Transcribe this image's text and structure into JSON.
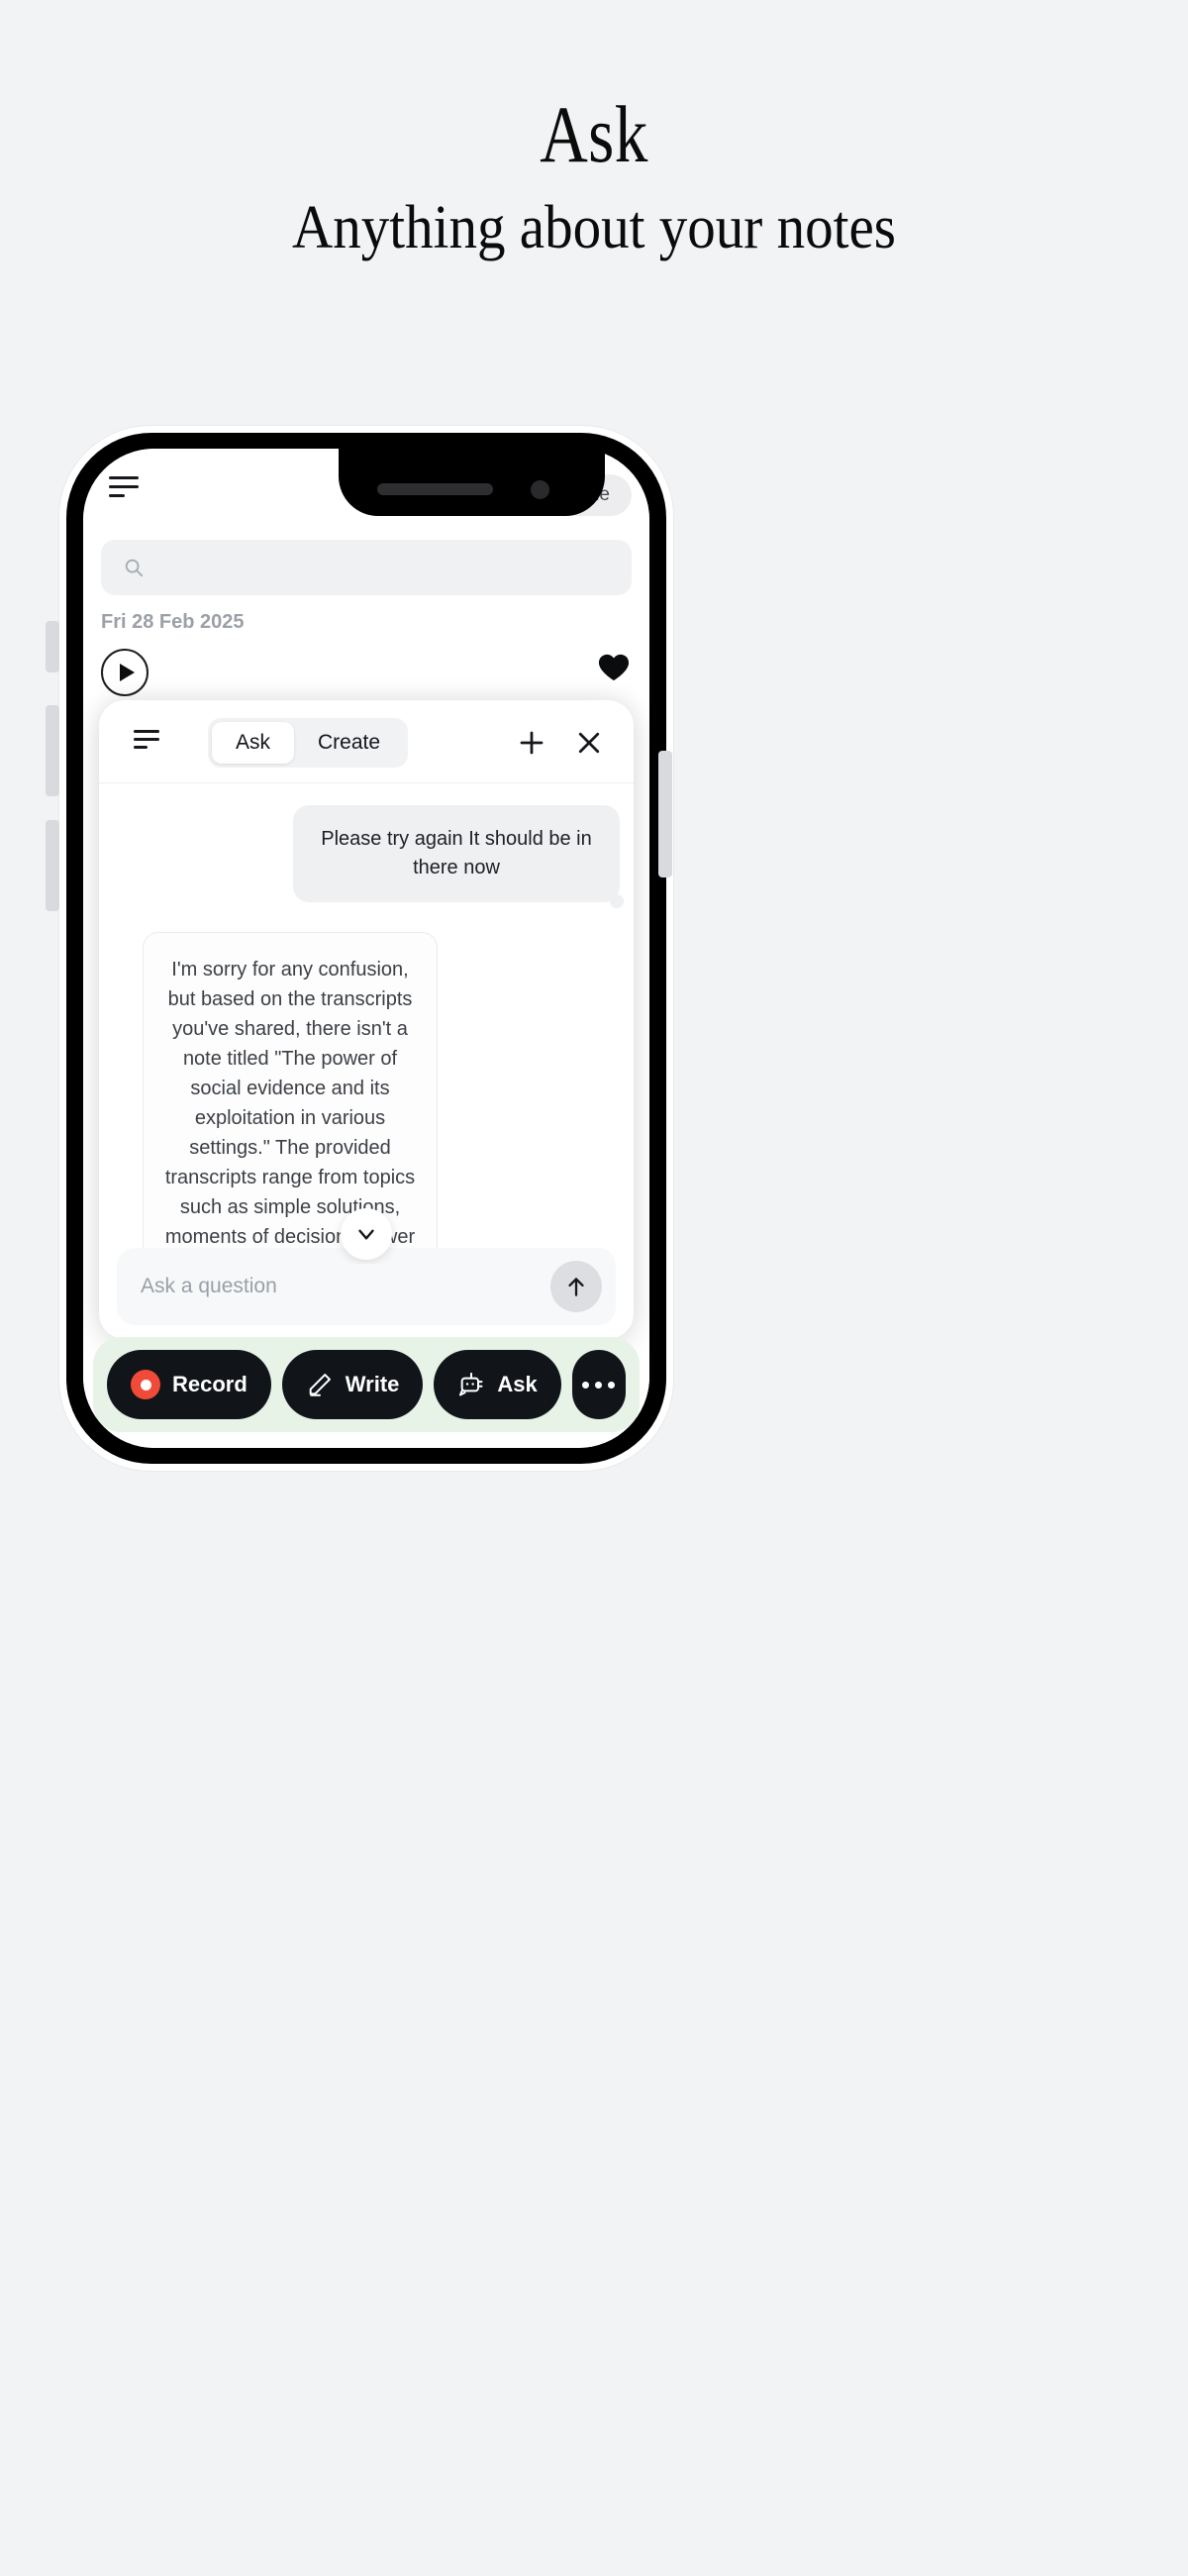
{
  "hero": {
    "title": "Ask",
    "subtitle": "Anything about your notes"
  },
  "app": {
    "topbar": {
      "menu_icon": "hamburger-icon",
      "upgrade_label": "Upgrade",
      "upgrade_icon": "sparkle-icon"
    },
    "search": {
      "icon": "search-icon",
      "placeholder": "",
      "value": ""
    },
    "note": {
      "date": "Fri 28 Feb 2025",
      "play_icon": "play-icon",
      "favorite_icon": "heart-filled-icon"
    },
    "ask_panel": {
      "menu_icon": "hamburger-icon",
      "tabs": [
        {
          "label": "Ask",
          "active": true
        },
        {
          "label": "Create",
          "active": false
        }
      ],
      "add_icon": "plus-icon",
      "close_icon": "close-icon",
      "scroll_icon": "chevron-down-icon",
      "messages": [
        {
          "role": "user",
          "text": "Please try again It should be in there now"
        },
        {
          "role": "assistant",
          "text": "I'm sorry for any confusion, but based on the transcripts you've shared, there isn't a note titled \"The power of social evidence and its exploitation in various settings.\" The provided transcripts range from topics such as simple solutions, moments of decision, viewer appreciation, to testing recording setups, among others. None of the titles or contents directly mention social evidence or its"
        }
      ],
      "composer": {
        "placeholder": "Ask a question",
        "value": "",
        "send_icon": "arrow-up-icon"
      }
    },
    "dock": {
      "items": [
        {
          "label": "Record",
          "icon": "record-dot-icon"
        },
        {
          "label": "Write",
          "icon": "pencil-icon"
        },
        {
          "label": "Ask",
          "icon": "robot-icon"
        },
        {
          "label": "",
          "icon": "ellipsis-icon"
        }
      ]
    }
  },
  "colors": {
    "page_background": "#f2f3f5",
    "dock_background": "#e7f3e7",
    "dock_pill": "#111419",
    "record_accent": "#f04a38",
    "text_primary": "#13151a",
    "text_muted": "#9ba0a7"
  }
}
